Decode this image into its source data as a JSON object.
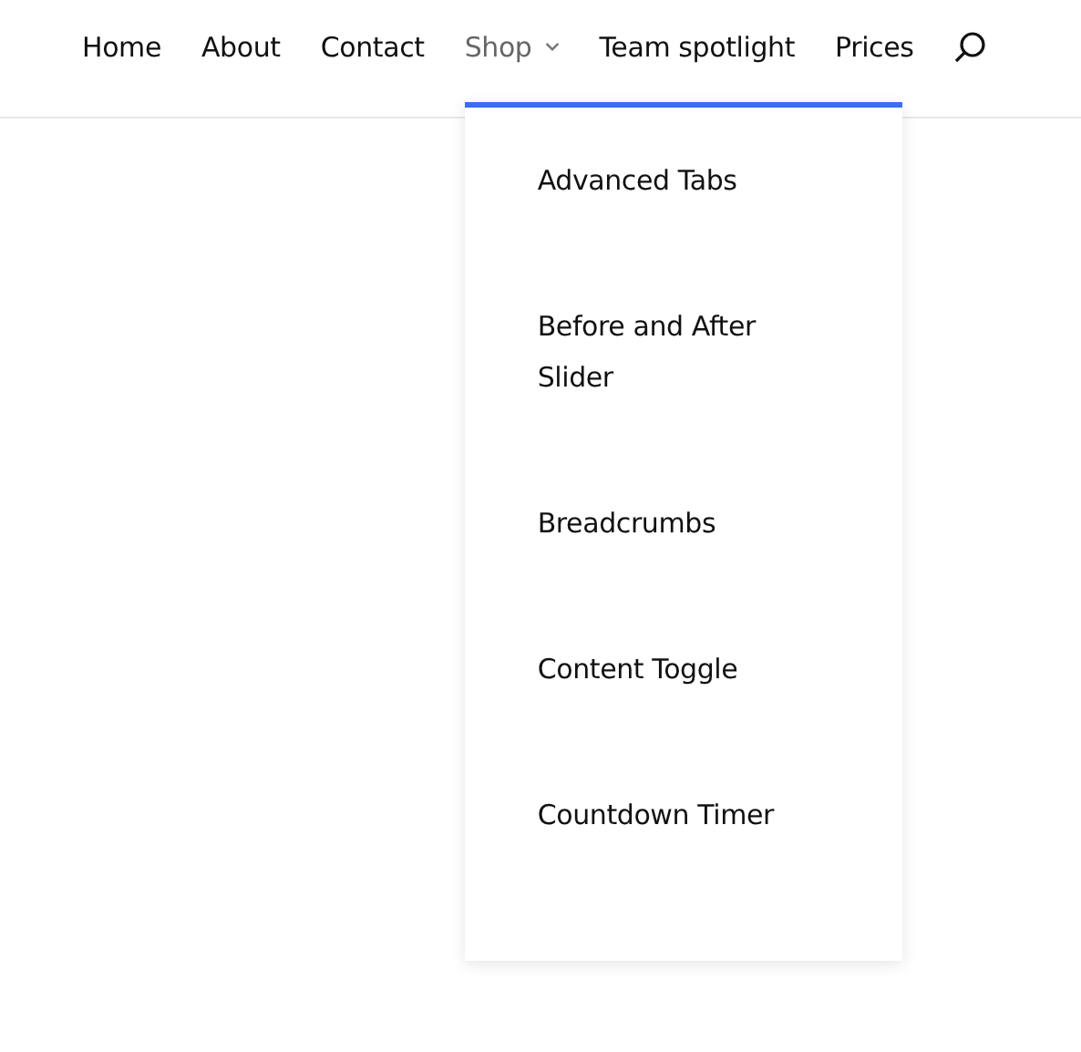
{
  "nav": {
    "items": [
      {
        "label": "Home",
        "selected": false,
        "has_submenu": false
      },
      {
        "label": "About",
        "selected": false,
        "has_submenu": false
      },
      {
        "label": "Contact",
        "selected": false,
        "has_submenu": false
      },
      {
        "label": "Shop",
        "selected": true,
        "has_submenu": true
      },
      {
        "label": "Team spotlight",
        "selected": false,
        "has_submenu": false
      },
      {
        "label": "Prices",
        "selected": false,
        "has_submenu": false
      }
    ]
  },
  "dropdown": {
    "items": [
      {
        "label": "Advanced Tabs"
      },
      {
        "label": "Before and After Slider"
      },
      {
        "label": "Breadcrumbs"
      },
      {
        "label": "Content Toggle"
      },
      {
        "label": "Countdown Timer"
      }
    ]
  }
}
